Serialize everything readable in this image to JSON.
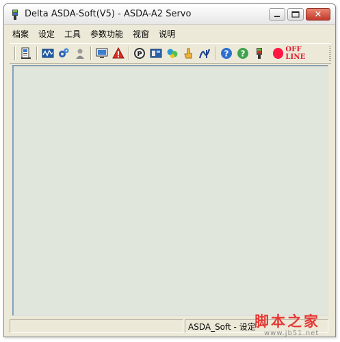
{
  "window": {
    "title": "Delta ASDA-Soft(V5) - ASDA-A2 Servo"
  },
  "menu": {
    "items": [
      {
        "label": "档案"
      },
      {
        "label": "设定"
      },
      {
        "label": "工具"
      },
      {
        "label": "参数功能"
      },
      {
        "label": "视窗"
      },
      {
        "label": "说明"
      }
    ]
  },
  "toolbar": {
    "icons": [
      "drive-properties-icon",
      "scope-icon",
      "gear-config-icon",
      "user-icon",
      "monitor-icon",
      "alarm-warning-icon",
      "parameter-icon",
      "drive-image-icon",
      "pr-path-icon",
      "jog-hand-icon",
      "tuning-icon",
      "help-icon",
      "diagnosis-icon",
      "connection-icon"
    ],
    "status_text": "OFF LINE",
    "status_color": "#ff1744"
  },
  "statusbar": {
    "pane1": "",
    "pane2": "ASDA_Soft - 设定"
  },
  "watermark": {
    "text": "脚本之家",
    "url": "www.jb51.net"
  },
  "colors": {
    "client_bg": "#e1e6dc",
    "chrome_bg": "#ece9d8",
    "close_button": "#c1392b"
  }
}
